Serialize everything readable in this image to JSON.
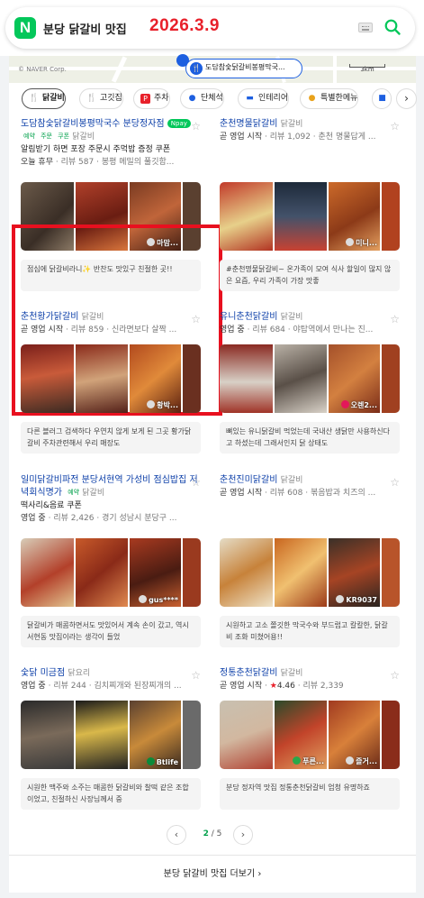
{
  "search": {
    "query": "분당 닭갈비 맛집",
    "stamp": "2026.3.9"
  },
  "map": {
    "copyright": "© NAVER Corp.",
    "pin_label": "도담참숯닭갈비봉평막국...",
    "pin_sub": "닭갈비",
    "scale": "3km"
  },
  "filters": [
    {
      "label": "닭갈비",
      "icon": "fork-knife-icon"
    },
    {
      "label": "고깃집",
      "icon": "fork-knife-icon"
    },
    {
      "label": "주차",
      "icon": "parking-icon"
    },
    {
      "label": "단체석",
      "icon": "group-icon"
    },
    {
      "label": "인테리어",
      "icon": "sofa-icon"
    },
    {
      "label": "특별한메뉴",
      "icon": "dish-icon"
    }
  ],
  "places": [
    {
      "name": "도담참숯닭갈비봉평막국수 분당정자점",
      "category": "닭갈비",
      "npay": "pay",
      "reserve": "예약",
      "order": "주문",
      "coupon": "쿠폰",
      "subline": "알림받기 하면 포장 주문시 주먹밥 증정 쿠폰",
      "status": "오늘 휴무",
      "reviews": "리뷰 587",
      "desc": "봉평 메밀의 풀깃함...",
      "photo_tag": "마맘...",
      "review": "점심에 닭갈비라니✨ 반찬도 맛있구 친절한 곳!!"
    },
    {
      "name": "춘천명물닭갈비",
      "category": "닭갈비",
      "status": "곧 영업 시작",
      "reviews": "리뷰 1,092",
      "desc": "춘천 명물답게 ...",
      "photo_tag": "미니...",
      "review": "#춘천명물닭갈비~ 온가족이 모여 식사 할일이 많지 않은 요즘, 우리 가족이 가장 맛좋"
    },
    {
      "name": "춘천황가닭갈비",
      "category": "닭갈비",
      "status": "곧 영업 시작",
      "reviews": "리뷰 859",
      "desc": "신라면보다 살짝 ...",
      "photo_tag": "황박...",
      "review": "다른 블러그 검색하다 우연치 않게 보게 된 그곳 황가닭갈비 주차관련해서 우리 매장도"
    },
    {
      "name": "유니춘천닭갈비",
      "category": "닭갈비",
      "status": "영업 중",
      "reviews": "리뷰 684",
      "desc": "야탑역에서 만나는 진...",
      "photo_tag": "오렌2...",
      "review": "뼈있는 유니닭갈비 먹었는데 국내산 생닭만 사용하신다고 하셨는데 그래서인지 닭 상태도"
    },
    {
      "name": "일미닭갈비파전 분당서현역 가성비 점심밥집 저녁회식명가",
      "category": "닭갈비",
      "reserve": "예약",
      "subline": "떡사리&음료 쿠폰",
      "status": "영업 중",
      "reviews": "리뷰 2,426",
      "desc": "경기 성남시 분당구 ...",
      "photo_tag": "gus****",
      "review": "닭갈비가 매콤하면서도 맛있어서 계속 손이 갔고, 역시 서현동 맛집이라는 생각이 들었"
    },
    {
      "name": "춘천진미닭갈비",
      "category": "닭갈비",
      "status": "곧 영업 시작",
      "reviews": "리뷰 608",
      "desc": "볶음밥과 치즈의 ...",
      "photo_tag": "KR9037",
      "review": "시원하고 고소 쫄깃한 막국수와 부드럽고 칼칼한, 닭갈비 조화 미쳤어용!!"
    },
    {
      "name": "숯닭 미금점",
      "category": "닭요리",
      "status": "영업 중",
      "reviews": "리뷰 244",
      "desc": "김치찌개와 된장찌개의 ...",
      "photo_tag": "Btlife",
      "review": "시원한 맥주와 소주는 매콤한 닭갈비와 찰떡 같은 조합이었고, 친절하신 사장님께서 중"
    },
    {
      "name": "정통춘천닭갈비",
      "category": "닭갈비",
      "status": "곧 영업 시작",
      "rating": "4.46",
      "reviews": "리뷰 2,339",
      "photo_tag": "푸른...",
      "photo_tag2": "즐거...",
      "review": "분당 정자역 맛집 정통춘천닭갈비 엄청 유명하죠"
    }
  ],
  "pager": {
    "current": "2",
    "total": "/ 5"
  },
  "more": "분당 닭갈비 맛집 더보기",
  "colors": {
    "naver_green": "#03c75a",
    "link_blue": "#0b3ea8",
    "highlight_red": "#e8101f"
  }
}
